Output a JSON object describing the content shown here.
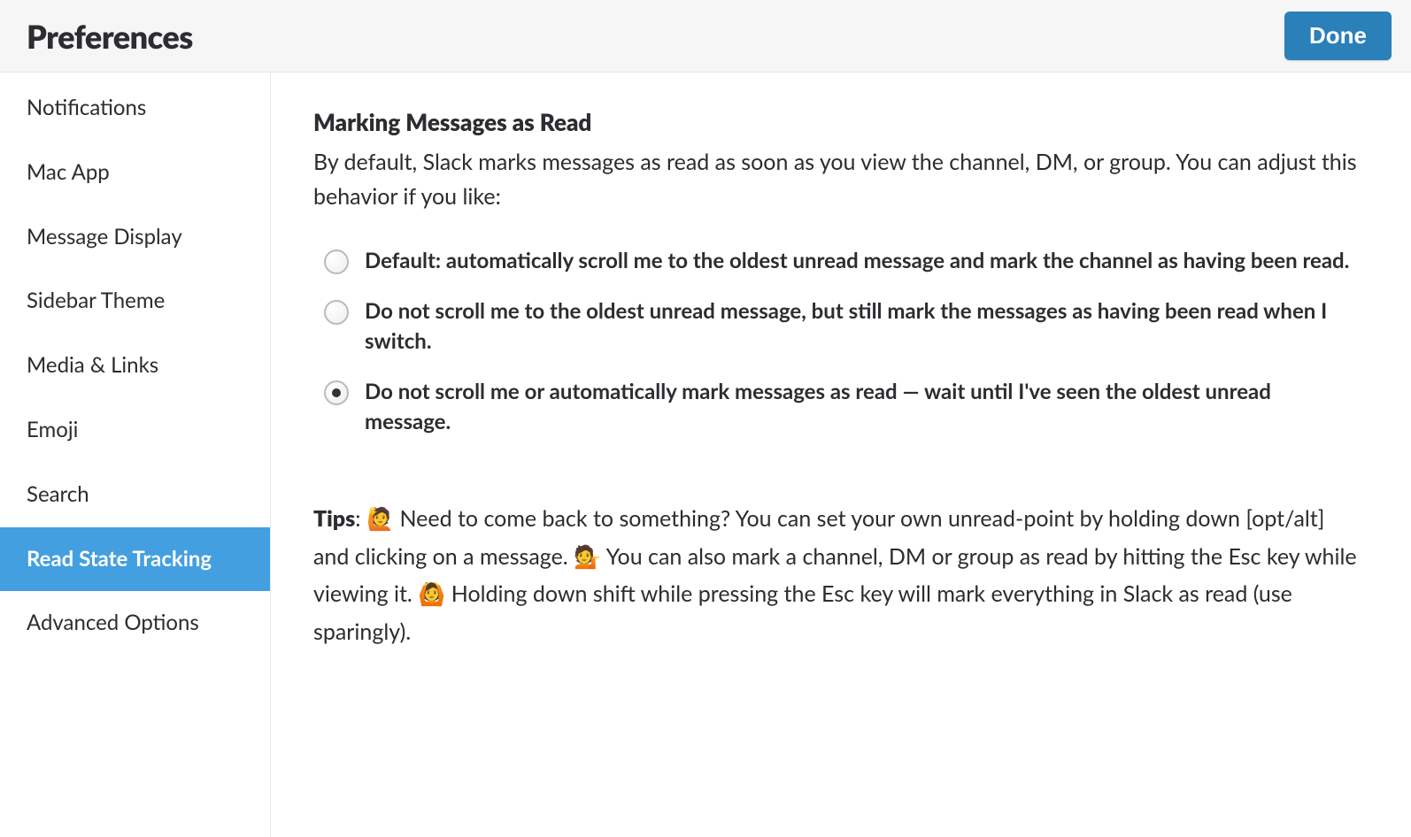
{
  "header": {
    "title": "Preferences",
    "done_label": "Done"
  },
  "sidebar": {
    "items": [
      {
        "label": "Notifications",
        "active": false
      },
      {
        "label": "Mac App",
        "active": false
      },
      {
        "label": "Message Display",
        "active": false
      },
      {
        "label": "Sidebar Theme",
        "active": false
      },
      {
        "label": "Media & Links",
        "active": false
      },
      {
        "label": "Emoji",
        "active": false
      },
      {
        "label": "Search",
        "active": false
      },
      {
        "label": "Read State Tracking",
        "active": true
      },
      {
        "label": "Advanced Options",
        "active": false
      }
    ]
  },
  "main": {
    "section_title": "Marking Messages as Read",
    "section_desc": "By default, Slack marks messages as read as soon as you view the channel, DM, or group. You can adjust this behavior if you like:",
    "options": [
      {
        "label": "Default: automatically scroll me to the oldest unread message and mark the channel as having been read.",
        "selected": false
      },
      {
        "label": "Do not scroll me to the oldest unread message, but still mark the messages as having been read when I switch.",
        "selected": false
      },
      {
        "label": "Do not scroll me or automatically mark messages as read — wait until I've seen the oldest unread message.",
        "selected": true
      }
    ],
    "tips": {
      "label": "Tips",
      "emoji1": "🙋",
      "text1": " Need to come back to something? You can set your own unread-point by holding down [opt/alt] and clicking on a message. ",
      "emoji2": "💁",
      "text2": " You can also mark a channel, DM or group as read by hitting the Esc key while viewing it. ",
      "emoji3": "🙆",
      "text3": " Holding down shift while pressing the Esc key will mark everything in Slack as read (use sparingly)."
    }
  }
}
